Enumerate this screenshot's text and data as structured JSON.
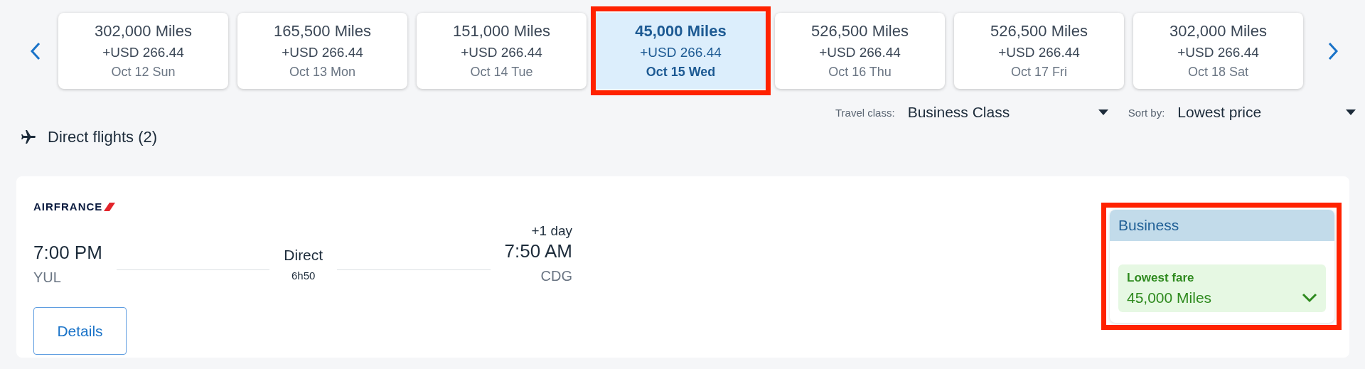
{
  "dates": [
    {
      "miles": "302,000 Miles",
      "usd": "+USD 266.44",
      "date": "Oct 12 Sun",
      "selected": false,
      "highlighted": false
    },
    {
      "miles": "165,500 Miles",
      "usd": "+USD 266.44",
      "date": "Oct 13 Mon",
      "selected": false,
      "highlighted": false
    },
    {
      "miles": "151,000 Miles",
      "usd": "+USD 266.44",
      "date": "Oct 14 Tue",
      "selected": false,
      "highlighted": false
    },
    {
      "miles": "45,000 Miles",
      "usd": "+USD 266.44",
      "date": "Oct 15 Wed",
      "selected": true,
      "highlighted": true
    },
    {
      "miles": "526,500 Miles",
      "usd": "+USD 266.44",
      "date": "Oct 16 Thu",
      "selected": false,
      "highlighted": false
    },
    {
      "miles": "526,500 Miles",
      "usd": "+USD 266.44",
      "date": "Oct 17 Fri",
      "selected": false,
      "highlighted": false
    },
    {
      "miles": "302,000 Miles",
      "usd": "+USD 266.44",
      "date": "Oct 18 Sat",
      "selected": false,
      "highlighted": false
    }
  ],
  "filters": [
    {
      "label": "Travel class:",
      "value": "Business Class"
    },
    {
      "label": "Sort by:",
      "value": "Lowest price"
    }
  ],
  "section_title": "Direct flights (2)",
  "flight": {
    "airline": "AIRFRANCE",
    "departure_time": "7:00 PM",
    "departure_airport": "YUL",
    "stops": "Direct",
    "duration": "6h50",
    "day_offset": "+1 day",
    "arrival_time": "7:50 AM",
    "arrival_airport": "CDG",
    "details_button": "Details",
    "fare": {
      "cabin": "Business",
      "label": "Lowest fare",
      "price": "45,000 Miles",
      "highlighted": true
    }
  }
}
